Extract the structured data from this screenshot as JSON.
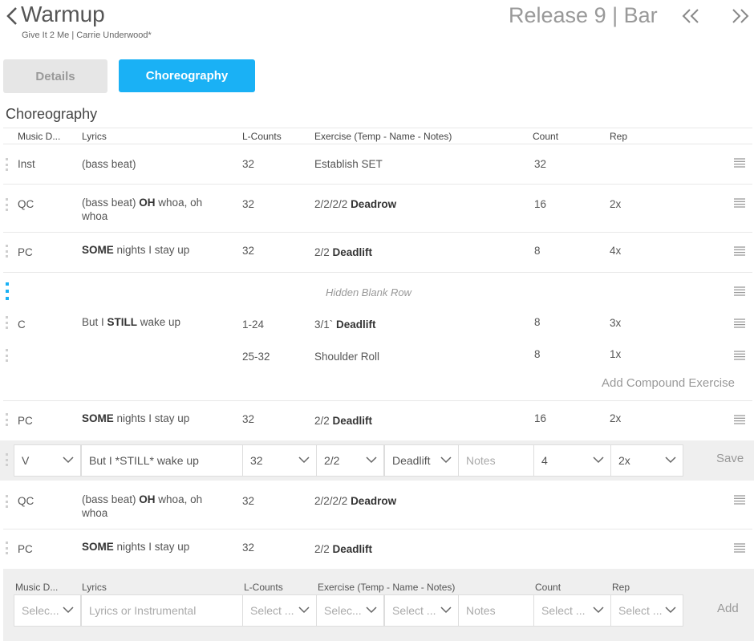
{
  "header": {
    "title": "Warmup",
    "subtitle": "Give It 2 Me | Carrie Underwood*",
    "release": "Release 9 | Bar"
  },
  "tabs": {
    "details": "Details",
    "choreography": "Choreography"
  },
  "section_title": "Choreography",
  "columns": {
    "music": "Music D...",
    "lyrics": "Lyrics",
    "lcounts": "L-Counts",
    "exercise": "Exercise (Temp - Name - Notes)",
    "count": "Count",
    "rep": "Rep"
  },
  "rows": [
    {
      "music": "Inst",
      "lyrics_pre": "(bass beat)",
      "lyrics_bold": "",
      "lyrics_post": "",
      "lcounts": "32",
      "tempo": "",
      "exercise": "Establish SET",
      "exercise_bold": false,
      "count": "32",
      "rep": ""
    },
    {
      "music": "QC",
      "lyrics_pre": "(bass beat) ",
      "lyrics_bold": "OH",
      "lyrics_post": " whoa, oh whoa",
      "lcounts": "32",
      "tempo": "2/2/2/2",
      "exercise": "Deadrow",
      "exercise_bold": true,
      "count": "16",
      "rep": "2x"
    },
    {
      "music": "PC",
      "lyrics_pre": "",
      "lyrics_bold": "SOME",
      "lyrics_post": " nights I stay up",
      "lcounts": "32",
      "tempo": "2/2",
      "exercise": "Deadlift",
      "exercise_bold": true,
      "count": "8",
      "rep": "4x"
    },
    {
      "music": "C",
      "lyrics_pre": "But I ",
      "lyrics_bold": "STILL",
      "lyrics_post": " wake up",
      "lcounts": "1-24",
      "tempo": "3/1`",
      "exercise": "Deadlift",
      "exercise_bold": true,
      "count": "8",
      "rep": "3x"
    },
    {
      "music": "",
      "lyrics_pre": "",
      "lyrics_bold": "",
      "lyrics_post": "",
      "lcounts": "25-32",
      "tempo": "",
      "exercise": "Shoulder Roll",
      "exercise_bold": false,
      "count": "8",
      "rep": "1x"
    },
    {
      "music": "PC",
      "lyrics_pre": "",
      "lyrics_bold": "SOME",
      "lyrics_post": " nights I stay up",
      "lcounts": "32",
      "tempo": "2/2",
      "exercise": "Deadlift",
      "exercise_bold": true,
      "count": "16",
      "rep": "2x"
    },
    {
      "music": "QC",
      "lyrics_pre": "(bass beat) ",
      "lyrics_bold": "OH",
      "lyrics_post": " whoa, oh whoa",
      "lcounts": "32",
      "tempo": "2/2/2/2",
      "exercise": "Deadrow",
      "exercise_bold": true,
      "count": "",
      "rep": ""
    },
    {
      "music": "PC",
      "lyrics_pre": "",
      "lyrics_bold": "SOME",
      "lyrics_post": " nights I stay up",
      "lcounts": "32",
      "tempo": "2/2",
      "exercise": "Deadlift",
      "exercise_bold": true,
      "count": "",
      "rep": ""
    }
  ],
  "hidden_blank_row": "Hidden Blank Row",
  "add_compound": "Add Compound Exercise",
  "edit_row": {
    "music": "V",
    "lyrics": "But I *STILL* wake up",
    "lcounts": "32",
    "tempo": "2/2",
    "exercise": "Deadlift",
    "notes_placeholder": "Notes",
    "count": "4",
    "rep": "2x",
    "save": "Save"
  },
  "add_row": {
    "music_placeholder": "Selec...",
    "lyrics_placeholder": "Lyrics or Instrumental",
    "lcounts_placeholder": "Select ...",
    "tempo_placeholder": "Selec...",
    "exercise_placeholder": "Select ...",
    "notes_placeholder": "Notes",
    "count_placeholder": "Select ...",
    "rep_placeholder": "Select ...",
    "add": "Add"
  },
  "colors": {
    "accent": "#1ab1f5",
    "band": "#efefef"
  }
}
